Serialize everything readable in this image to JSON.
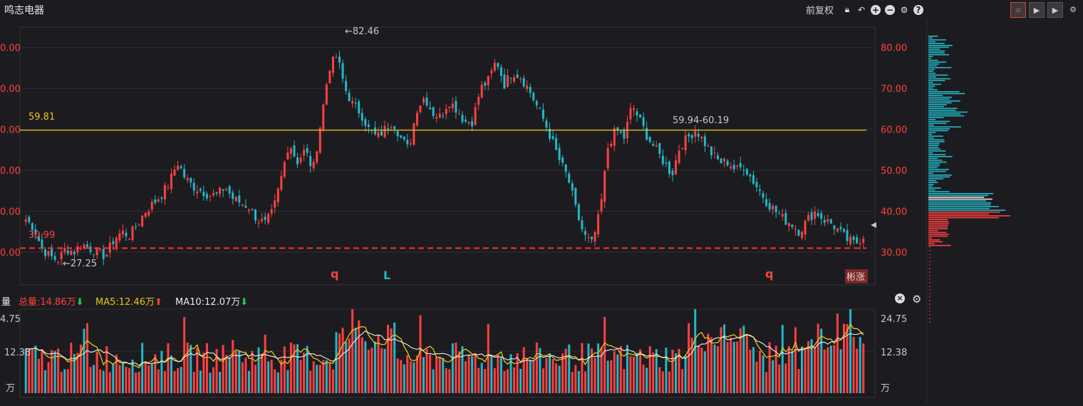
{
  "app": {
    "title": "鸣志电器"
  },
  "toolbar": {
    "adjust_label": "前复权",
    "icons": [
      "lock-icon",
      "undo-icon",
      "zoom-in-icon",
      "zoom-out-icon",
      "gear-icon",
      "help-icon"
    ],
    "view_tools": [
      "list-view-icon",
      "play-icon",
      "play-icon",
      "gear-icon"
    ]
  },
  "main_chart": {
    "y_ticks": [
      "80.00",
      "70.00",
      "60.00",
      "50.00",
      "40.00",
      "30.00"
    ],
    "y_ticks_left": [
      "0.00",
      "0.00",
      "0.00",
      "0.00",
      "0.00",
      "0.00"
    ],
    "high_label": "←82.46",
    "low_label": "←27.25",
    "resistance_label": "59.81",
    "support_label": "30.99",
    "range_label": "59.94-60.19",
    "markers": [
      {
        "text": "q",
        "color": "#ff4040"
      },
      {
        "text": "L",
        "color": "#22b8c8"
      },
      {
        "text": "q",
        "color": "#ff4040"
      }
    ],
    "badge": "彬涨",
    "colors": {
      "up": "#ff4040",
      "down": "#22b8c8",
      "line": "#e6c619",
      "support": "#ff3030"
    }
  },
  "volume": {
    "label": "量",
    "total": "总量:14.86万",
    "ma5": "MA5:12.46万",
    "ma10": "MA10:12.07万",
    "y_ticks": [
      "24.75",
      "12.38",
      "万"
    ],
    "y_ticks_left": [
      "4.75",
      "12.38",
      "万"
    ]
  },
  "chart_data": {
    "type": "candlestick",
    "y_range": [
      22,
      85
    ],
    "high": 82.46,
    "low": 27.25,
    "resistance": 59.81,
    "support": 30.99,
    "close_sequence": [
      38,
      36,
      31,
      29,
      28,
      31,
      30,
      32,
      31,
      30,
      29,
      33,
      35,
      34,
      37,
      40,
      42,
      44,
      47,
      52,
      48,
      46,
      45,
      44,
      44,
      46,
      43,
      42,
      41,
      38,
      37,
      40,
      48,
      57,
      52,
      55,
      50,
      62,
      75,
      78,
      70,
      66,
      64,
      60,
      58,
      60,
      62,
      58,
      55,
      65,
      68,
      64,
      63,
      67,
      65,
      62,
      62,
      70,
      72,
      77,
      71,
      74,
      73,
      70,
      66,
      62,
      57,
      52,
      48,
      40,
      34,
      32,
      40,
      56,
      60,
      58,
      66,
      62,
      58,
      55,
      52,
      49,
      56,
      58,
      60,
      57,
      54,
      52,
      52,
      50,
      51,
      48,
      45,
      42,
      40,
      38,
      37,
      35,
      38,
      40,
      38,
      37,
      35,
      33,
      32,
      34
    ],
    "volume_range": [
      0,
      24.75
    ],
    "volume_ma5_last": 12.46,
    "volume_ma10_last": 12.07,
    "volume_total_last": 14.86
  }
}
